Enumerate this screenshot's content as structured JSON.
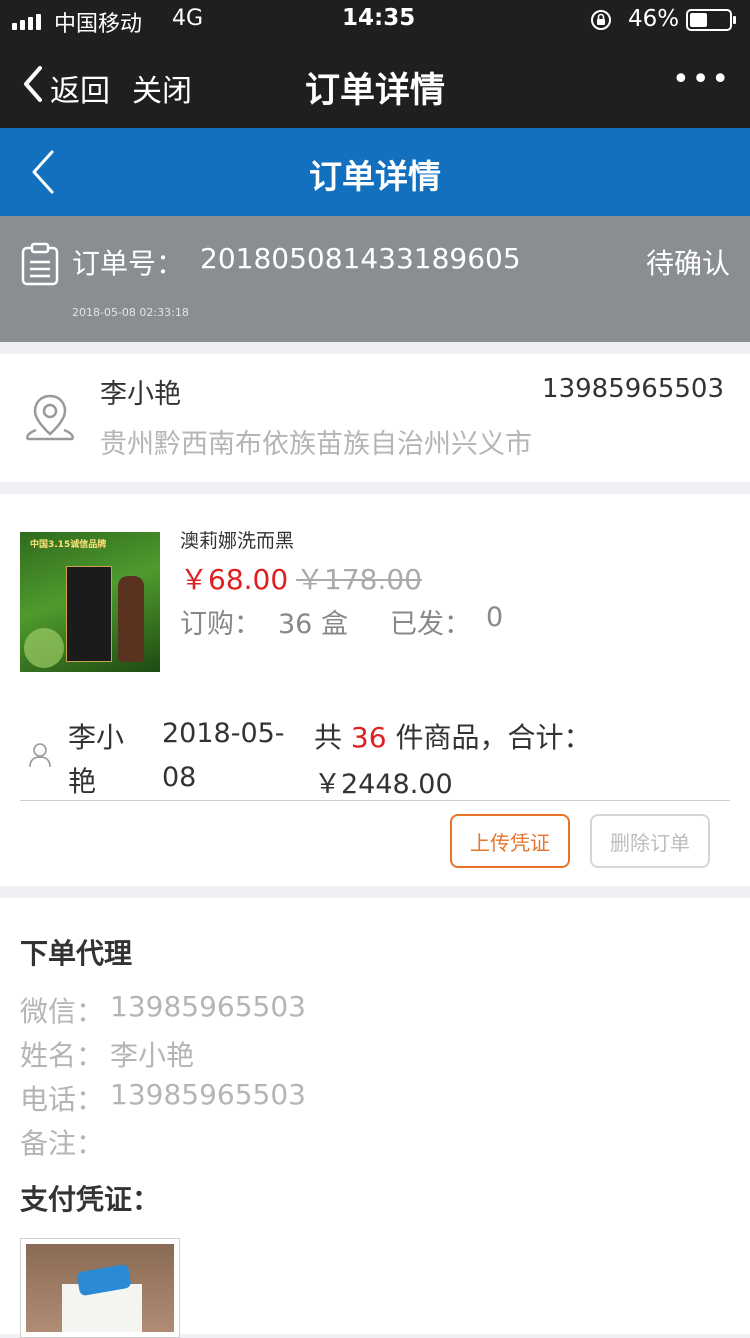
{
  "status": {
    "carrier": "中国移动",
    "network": "4G",
    "time": "14:35",
    "battery": "46%",
    "battery_level": 0.46
  },
  "wechat_bar": {
    "back_label": "返回",
    "close_label": "关闭",
    "title": "订单详情",
    "more_label": "•••"
  },
  "app_bar": {
    "title": "订单详情"
  },
  "order": {
    "no_label": "订单号：",
    "no_value": "201805081433189605",
    "status": "待确认",
    "datetime": "2018-05-08 02:33:18"
  },
  "address": {
    "name": "李小艳",
    "phone": "13985965503",
    "region": "贵州黔西南布依族苗族自治州兴义市"
  },
  "product": {
    "image_banner": "中国3.15诚信品牌",
    "name": "澳莉娜洗而黑",
    "price": "￥68.00",
    "original_price": "￥178.00",
    "qty_label": "订购：",
    "qty_value": "36 盒",
    "shipped_label": "已发：",
    "shipped_value": "0"
  },
  "summary": {
    "buyer_line1": "李小",
    "buyer_line2": "艳",
    "date_line1": "2018-05-",
    "date_line2": "08",
    "count_prefix": "共",
    "count": "36",
    "count_suffix": "件商品，合计：",
    "total": "￥2448.00"
  },
  "actions": {
    "upload_label": "上传凭证",
    "delete_label": "删除订单",
    "accent": "#e8742a"
  },
  "agent": {
    "title": "下单代理",
    "wechat_label": "微信：",
    "wechat_value": "13985965503",
    "name_label": "姓名：",
    "name_value": "李小艳",
    "phone_label": "电话：",
    "phone_value": "13985965503",
    "remark_label": "备注：",
    "remark_value": "",
    "voucher_title": "支付凭证："
  },
  "colors": {
    "app_blue": "#1270bf",
    "price_red": "#e02020"
  }
}
